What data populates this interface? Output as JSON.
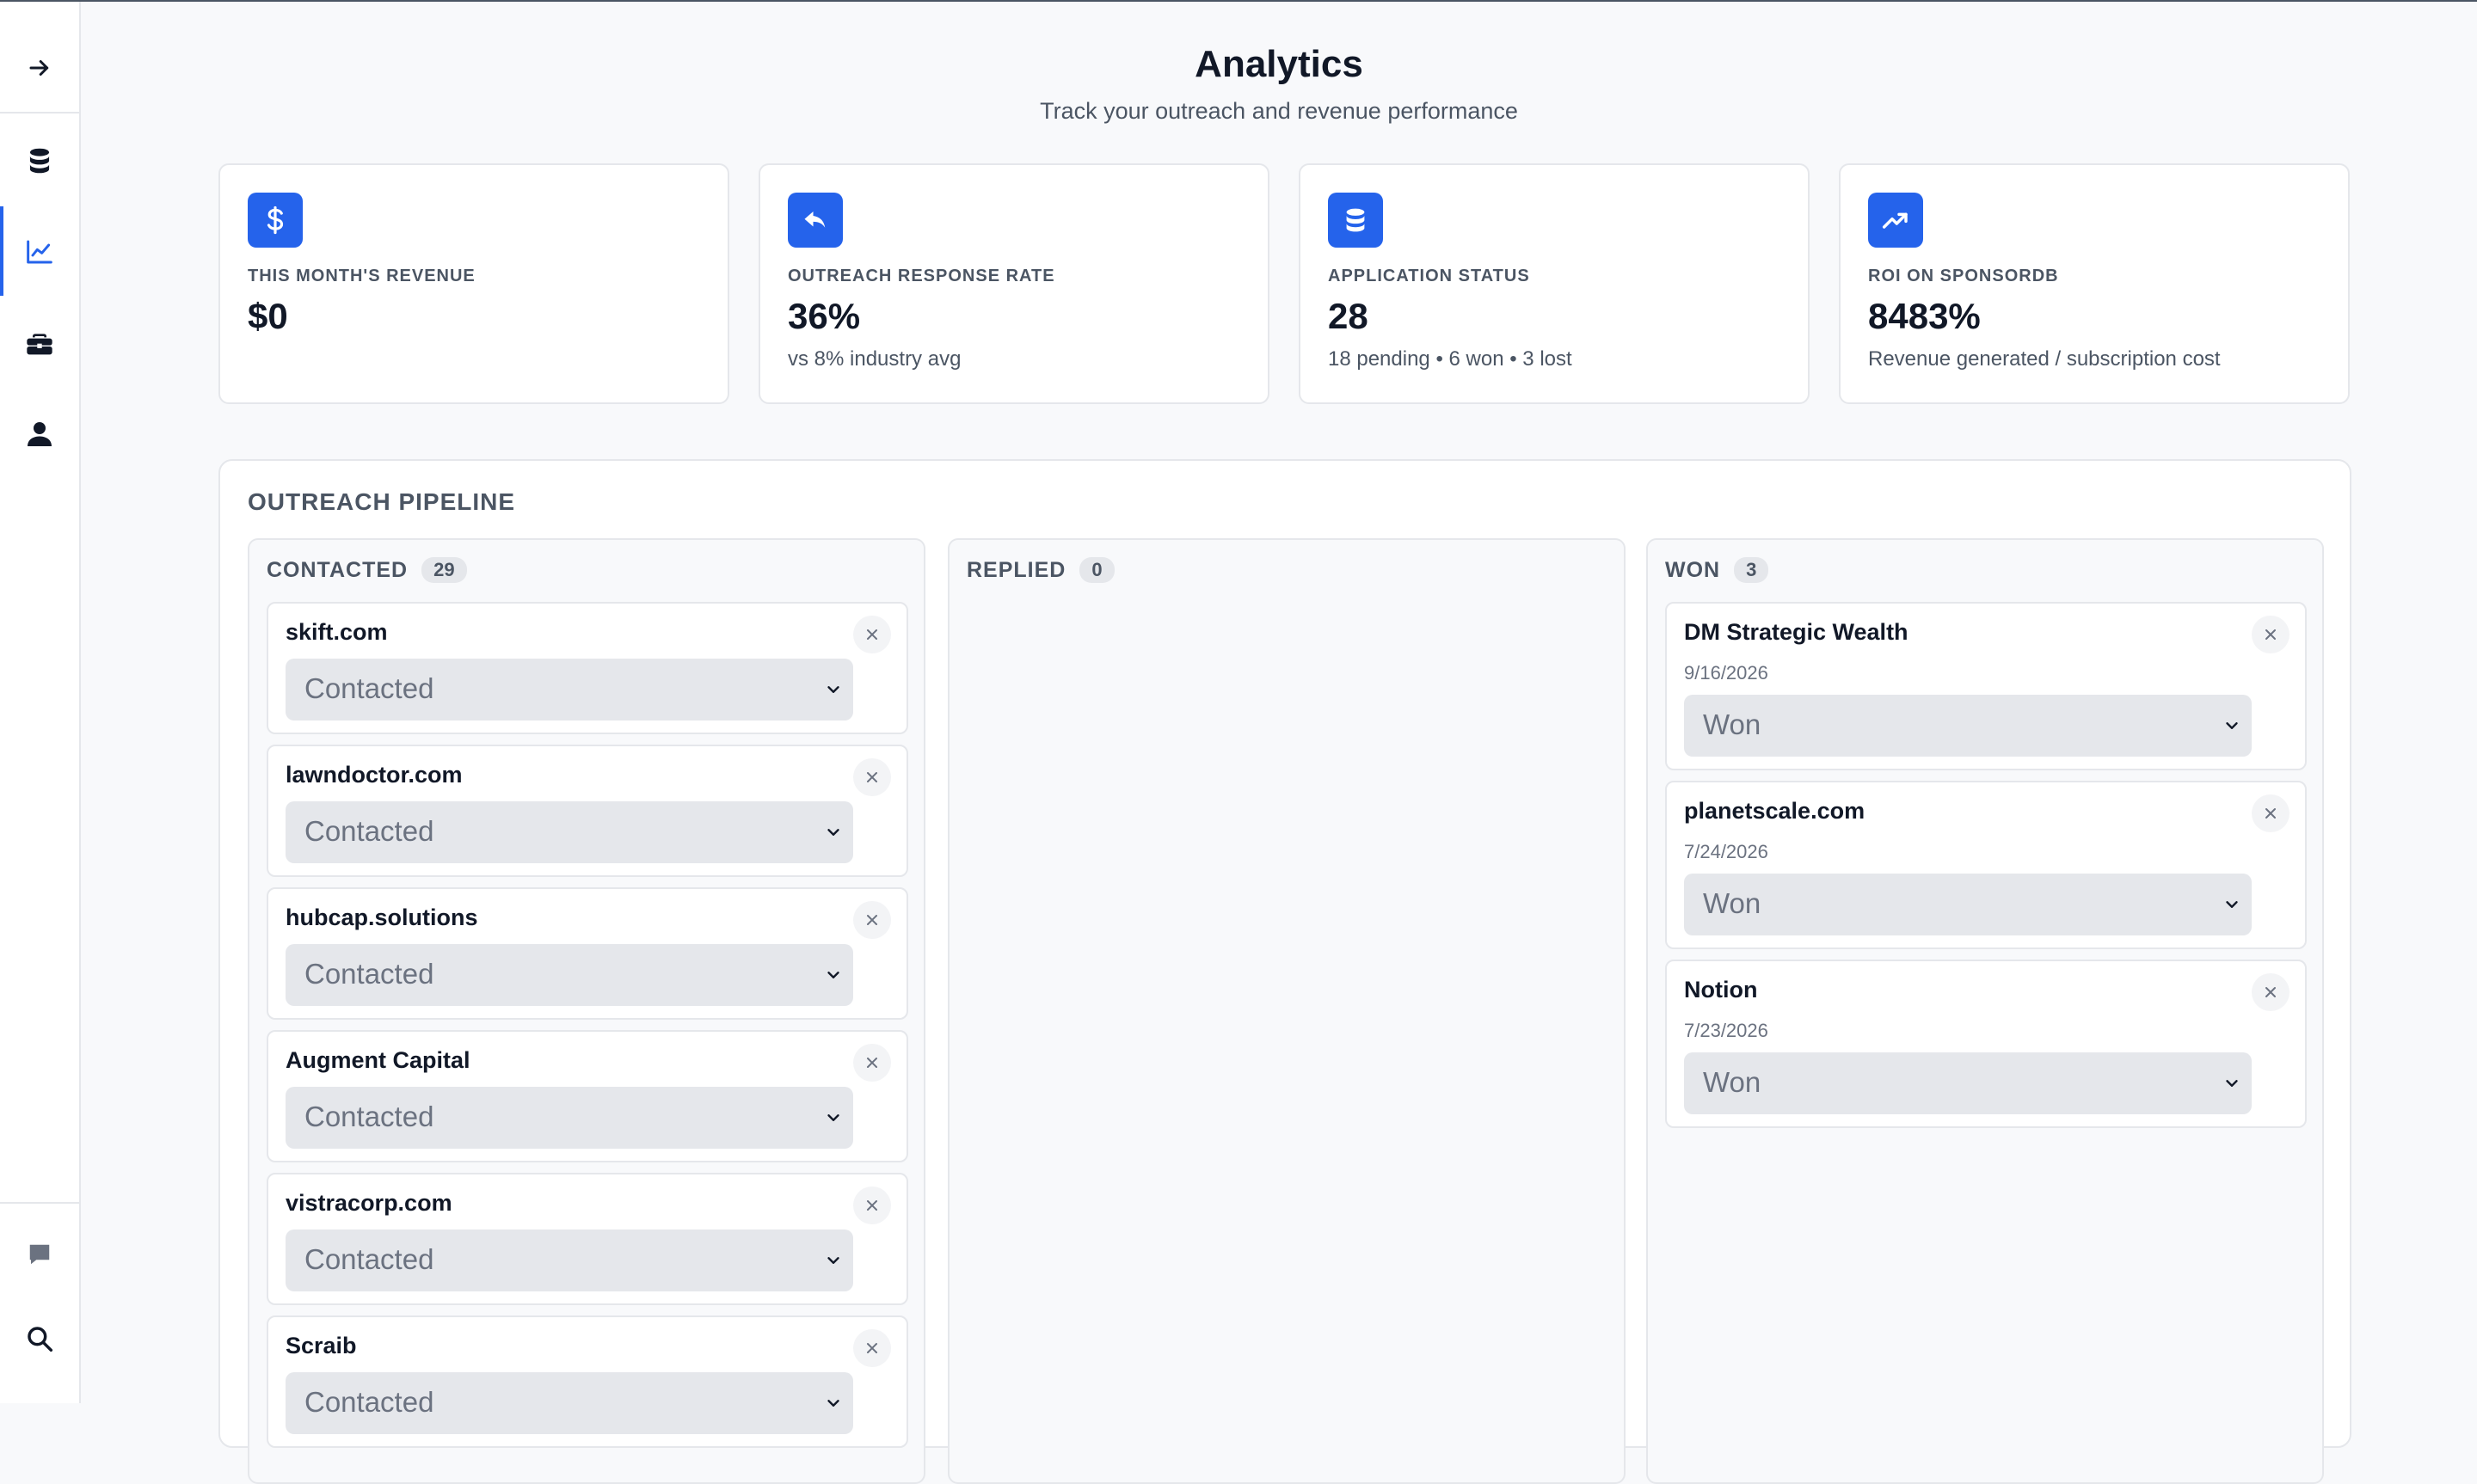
{
  "header": {
    "title": "Analytics",
    "subtitle": "Track your outreach and revenue performance"
  },
  "sidebar": {
    "items": [
      {
        "icon": "arrow-right-icon",
        "active": false
      },
      {
        "icon": "database-icon",
        "active": false
      },
      {
        "icon": "chart-line-icon",
        "active": true
      },
      {
        "icon": "briefcase-icon",
        "active": false
      },
      {
        "icon": "user-icon",
        "active": false
      }
    ],
    "bottom": [
      {
        "icon": "chat-icon"
      },
      {
        "icon": "search-icon"
      }
    ],
    "accent": "#2563eb"
  },
  "stats": [
    {
      "icon": "dollar-icon",
      "label": "THIS MONTH'S REVENUE",
      "value": "$0",
      "sub": ""
    },
    {
      "icon": "reply-icon",
      "label": "OUTREACH RESPONSE RATE",
      "value": "36%",
      "sub": "vs 8% industry avg"
    },
    {
      "icon": "database-icon",
      "label": "APPLICATION STATUS",
      "value": "28",
      "sub": "18 pending • 6 won • 3 lost"
    },
    {
      "icon": "trending-up-icon",
      "label": "ROI ON SPONSORDB",
      "value": "8483%",
      "sub": "Revenue generated / subscription cost"
    }
  ],
  "pipeline": {
    "title": "OUTREACH PIPELINE",
    "columns": [
      {
        "name": "CONTACTED",
        "count": "29",
        "leads": [
          {
            "name": "skift.com",
            "date": "",
            "status": "Contacted"
          },
          {
            "name": "lawndoctor.com",
            "date": "",
            "status": "Contacted"
          },
          {
            "name": "hubcap.solutions",
            "date": "",
            "status": "Contacted"
          },
          {
            "name": "Augment Capital",
            "date": "",
            "status": "Contacted"
          },
          {
            "name": "vistracorp.com",
            "date": "",
            "status": "Contacted"
          },
          {
            "name": "Scraib",
            "date": "",
            "status": "Contacted"
          }
        ]
      },
      {
        "name": "REPLIED",
        "count": "0",
        "leads": []
      },
      {
        "name": "WON",
        "count": "3",
        "leads": [
          {
            "name": "DM Strategic Wealth",
            "date": "9/16/2026",
            "status": "Won"
          },
          {
            "name": "planetscale.com",
            "date": "7/24/2026",
            "status": "Won"
          },
          {
            "name": "Notion",
            "date": "7/23/2026",
            "status": "Won"
          }
        ]
      }
    ]
  }
}
